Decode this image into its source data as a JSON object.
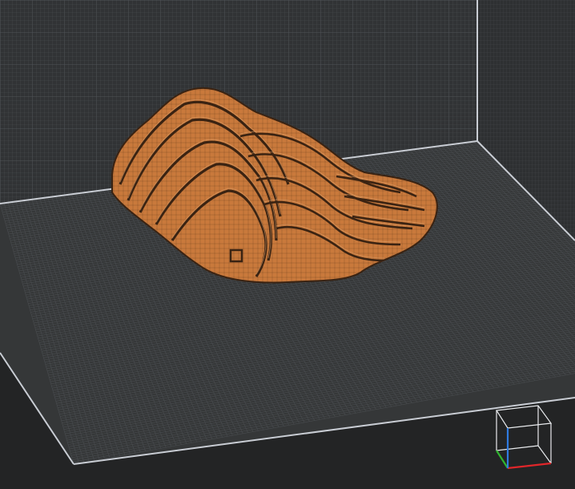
{
  "viewport": {
    "scene": "voxel-editor-3d-view",
    "background_color": "#232425",
    "grid_floor_color": "#333536",
    "grid_wall_color": "#313335",
    "grid_line_color": "#494c4f",
    "grid_line_major_color": "#55595c",
    "boundary_line_color": "#c8ccd4",
    "voxel_color": "#c9793c",
    "voxel_shadow_color": "#3a2312",
    "voxel_highlight_color": "#e0a067"
  },
  "orientation_gizmo": {
    "name": "view-cube",
    "axis_x_color": "#e0262a",
    "axis_y_color": "#2fb52f",
    "axis_z_color": "#2f7be0",
    "frame_color": "#e9ebee"
  },
  "model": {
    "name": "voxel-rock-model"
  }
}
